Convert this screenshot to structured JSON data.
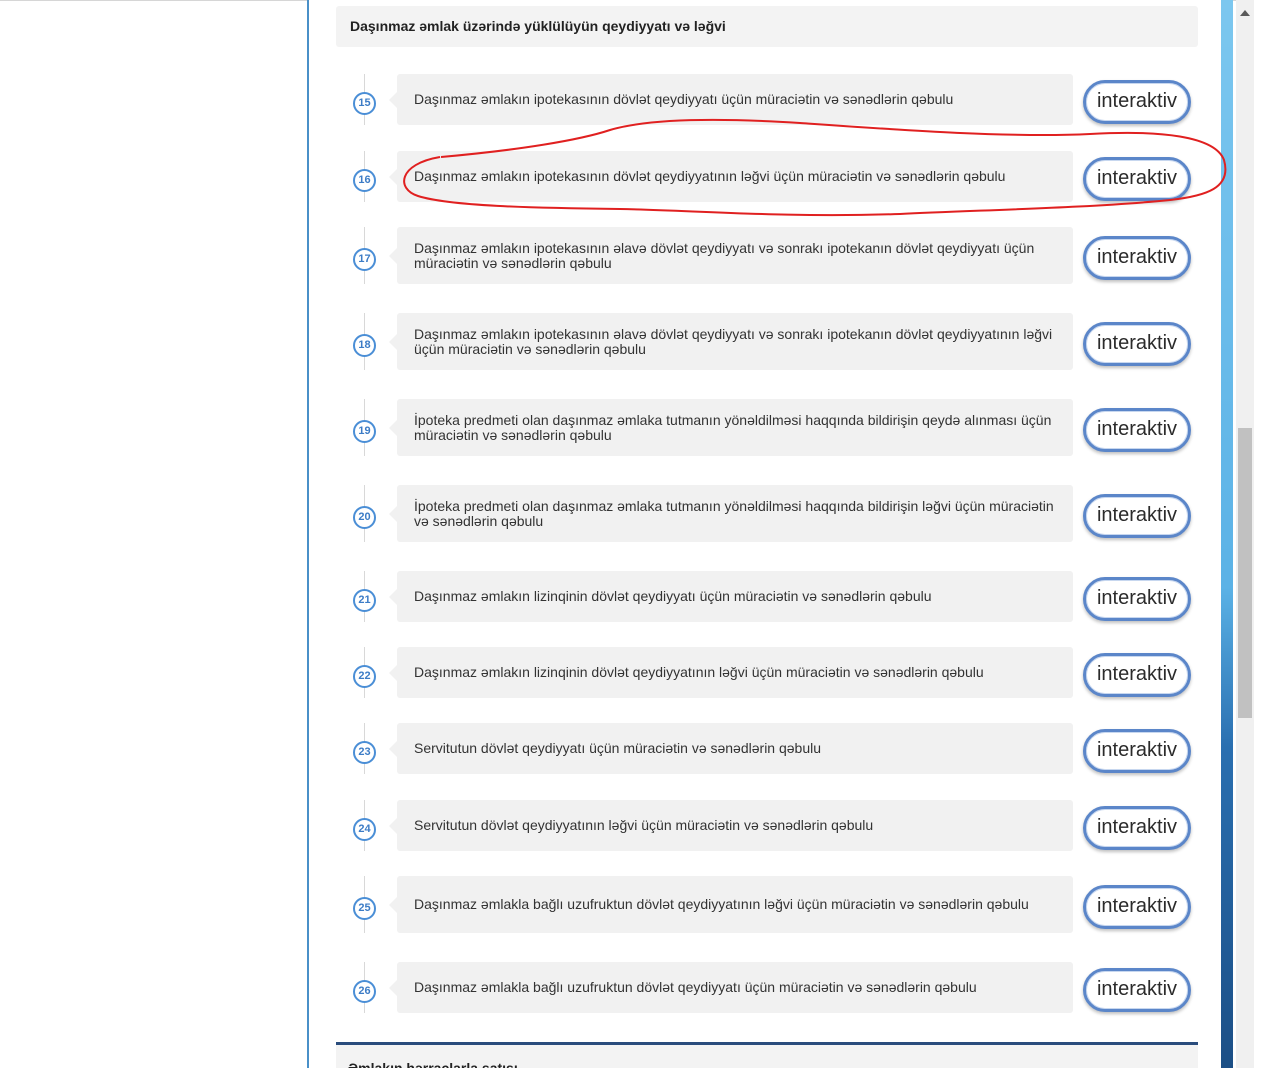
{
  "section_title": "Daşınmaz əmlak üzərində yüklülüyün qeydiyyatı və ləğvi",
  "button_label": "interaktiv",
  "items": [
    {
      "num": "15",
      "text": "Daşınmaz əmlakın ipotekasının dövlət qeydiyyatı üçün müraciətin və sənədlərin qəbulu"
    },
    {
      "num": "16",
      "text": "Daşınmaz əmlakın ipotekasının dövlət qeydiyyatının ləğvi üçün müraciətin və sənədlərin qəbulu"
    },
    {
      "num": "17",
      "text": "Daşınmaz əmlakın ipotekasının əlavə dövlət qeydiyyatı və sonrakı ipotekanın dövlət qeydiyyatı üçün müraciətin və sənədlərin qəbulu"
    },
    {
      "num": "18",
      "text": "Daşınmaz əmlakın ipotekasının əlavə dövlət qeydiyyatı və sonrakı ipotekanın dövlət qeydiyyatının ləğvi üçün müraciətin və sənədlərin qəbulu"
    },
    {
      "num": "19",
      "text": "İpoteka predmeti olan daşınmaz əmlaka tutmanın yönəldilməsi haqqında bildirişin qeydə alınması üçün müraciətin və sənədlərin qəbulu"
    },
    {
      "num": "20",
      "text": "İpoteka predmeti olan daşınmaz əmlaka tutmanın yönəldilməsi haqqında bildirişin ləğvi üçün müraciətin və sənədlərin qəbulu"
    },
    {
      "num": "21",
      "text": "Daşınmaz əmlakın lizinqinin dövlət qeydiyyatı üçün müraciətin və sənədlərin qəbulu"
    },
    {
      "num": "22",
      "text": "Daşınmaz əmlakın lizinqinin dövlət qeydiyyatının ləğvi üçün müraciətin və sənədlərin qəbulu"
    },
    {
      "num": "23",
      "text": "Servitutun dövlət qeydiyyatı üçün müraciətin və sənədlərin qəbulu"
    },
    {
      "num": "24",
      "text": "Servitutun dövlət qeydiyyatının ləğvi üçün müraciətin və sənədlərin qəbulu"
    },
    {
      "num": "25",
      "text": "Daşınmaz əmlakla bağlı uzufruktun dövlət qeydiyyatının ləğvi üçün müraciətin və sənədlərin qəbulu"
    },
    {
      "num": "26",
      "text": "Daşınmaz əmlakla bağlı uzufruktun dövlət qeydiyyatı üçün müraciətin və sənədlərin qəbulu"
    }
  ],
  "next_section_title": "Əmlakın hərraclarla satışı",
  "colors": {
    "accent_blue": "#4a8ed6",
    "button_border": "#5b86c9",
    "annotation_red": "#e02020",
    "footer_rule": "#2a4c7c"
  }
}
